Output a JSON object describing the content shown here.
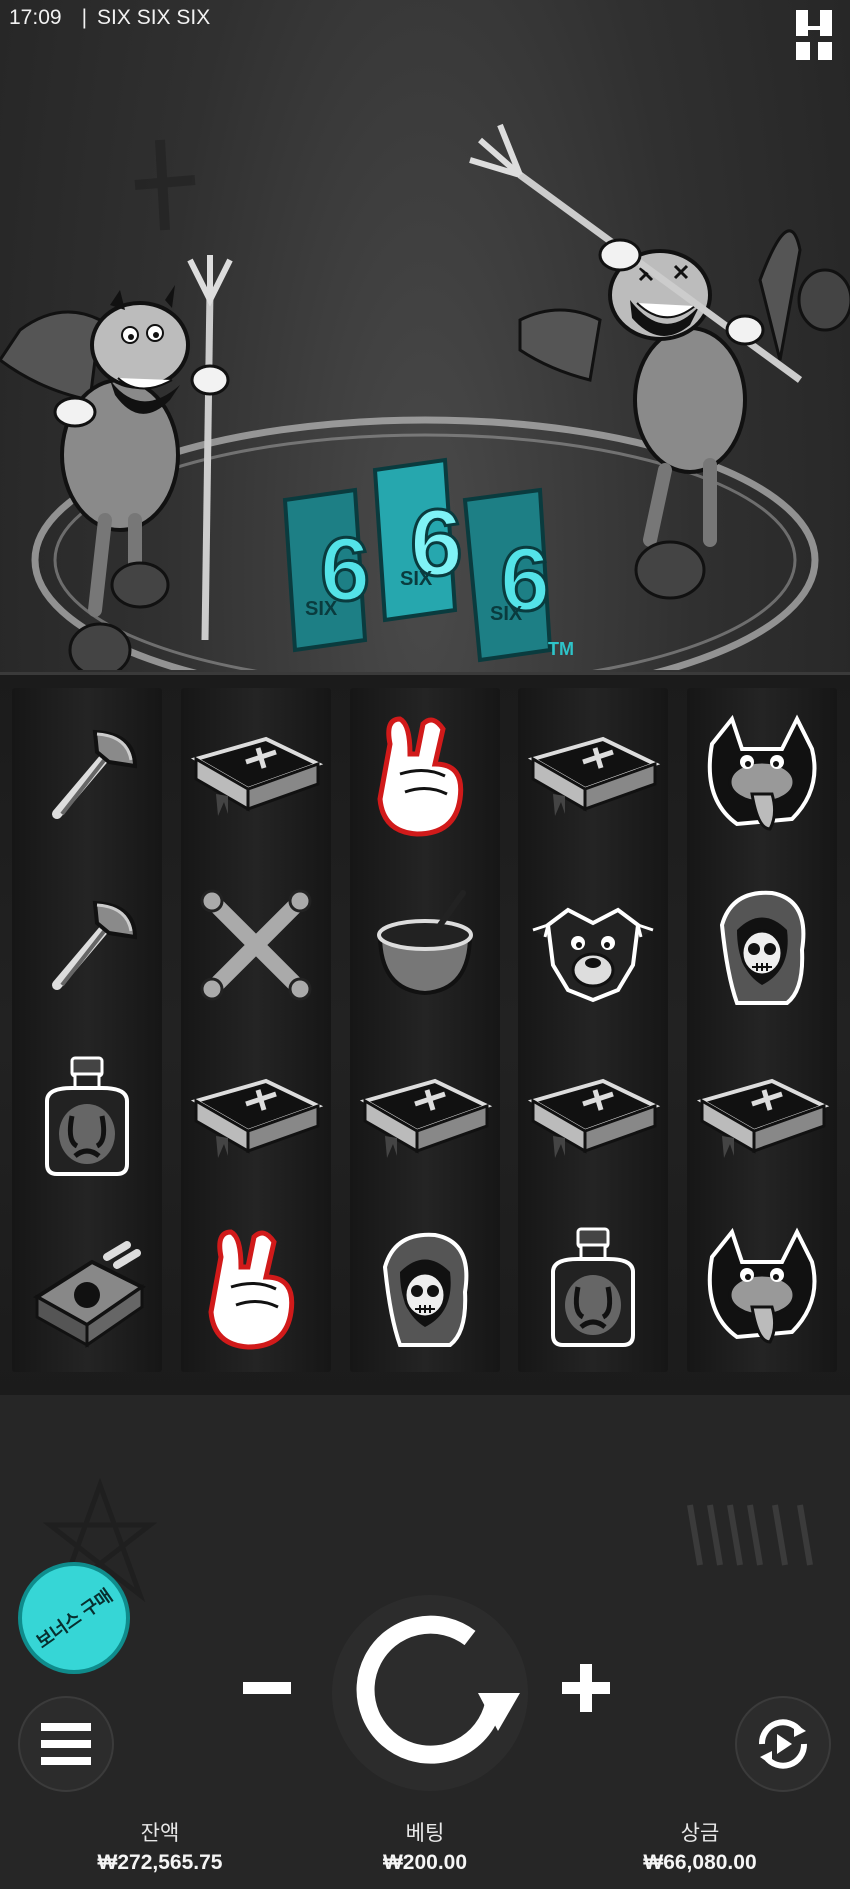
{
  "status_bar": {
    "time": "17:09",
    "separator": "|",
    "game_title": "SIX SIX SIX"
  },
  "logo": {
    "lettering": "666 SIX SIX SIX TM"
  },
  "reels": [
    [
      "axe",
      "axe",
      "potion-bottle",
      "cigarette-pack"
    ],
    [
      "bible",
      "crossed-bones",
      "bible",
      "horns-hand"
    ],
    [
      "horns-hand",
      "cauldron",
      "bible",
      "grim-reaper"
    ],
    [
      "bible",
      "goat",
      "bible",
      "potion-bottle"
    ],
    [
      "wolf",
      "grim-reaper",
      "bible",
      "wolf"
    ]
  ],
  "controls": {
    "bonus_buy_label": "보너스 구매",
    "minus_label": "−",
    "plus_label": "+"
  },
  "stats": {
    "balance_label": "잔액",
    "balance_value": "₩272,565.75",
    "bet_label": "베팅",
    "bet_value": "₩200.00",
    "win_label": "상금",
    "win_value": "₩66,080.00"
  },
  "colors": {
    "accent": "#36d6d6",
    "logo_teal": "#2ec4c9",
    "horns_outline": "#d11a1a"
  }
}
